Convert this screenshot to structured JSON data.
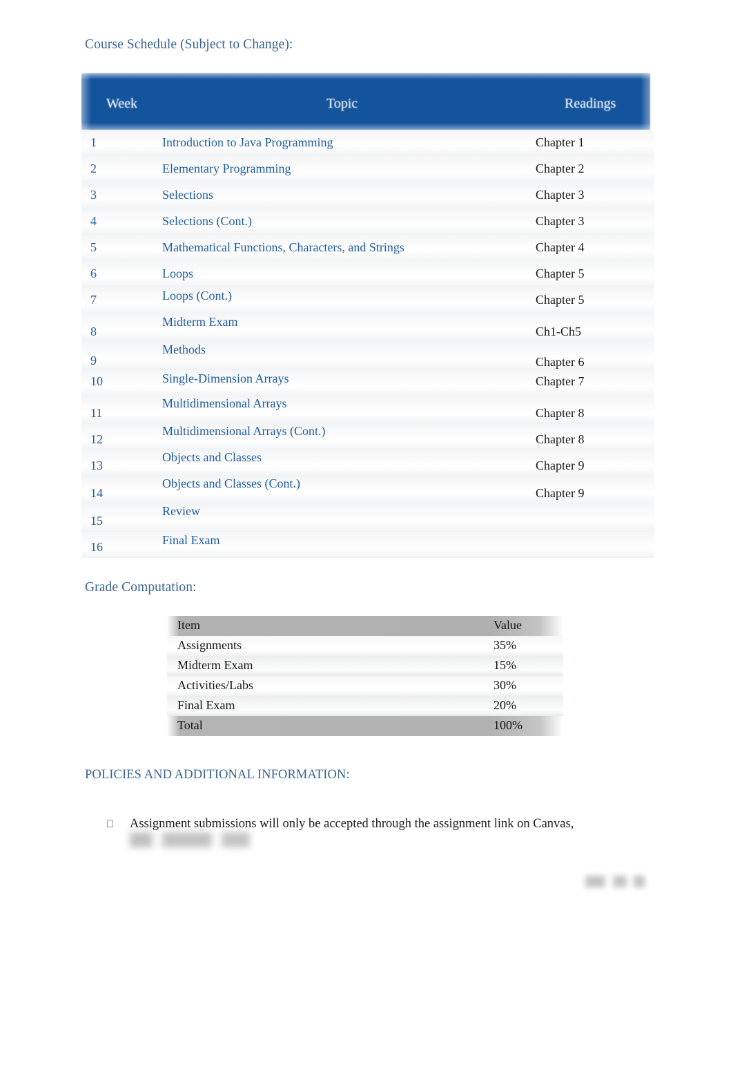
{
  "document": {
    "schedule_heading": "Course Schedule (Subject to Change):",
    "grades_heading": "Grade Computation:",
    "policies_heading": "POLICIES AND ADDITIONAL INFORMATION:"
  },
  "colors": {
    "table_header_blue": "#14549d",
    "body_text_blue": "#1f5c9e",
    "heading_blue": "#3a6490",
    "grade_header_gray": "#b2b2b2",
    "readings_text": "#1a1a1a"
  },
  "schedule_table": {
    "columns": [
      "Week",
      "Topic",
      "Readings"
    ],
    "rows": [
      {
        "week": "1",
        "topic": "Introduction to Java Programming",
        "readings": "Chapter 1"
      },
      {
        "week": "2",
        "topic": "Elementary Programming",
        "readings": "Chapter 2"
      },
      {
        "week": "3",
        "topic": "Selections",
        "readings": "Chapter 3"
      },
      {
        "week": "4",
        "topic": "Selections (Cont.)",
        "readings": "Chapter 3"
      },
      {
        "week": "5",
        "topic": "Mathematical Functions, Characters, and Strings",
        "readings": "Chapter 4"
      },
      {
        "week": "6",
        "topic": "Loops",
        "readings": "Chapter 5"
      },
      {
        "week": "7",
        "topic": "Loops (Cont.)",
        "readings": "Chapter 5"
      },
      {
        "week": "8",
        "topic": "Midterm Exam",
        "readings": "Ch1-Ch5"
      },
      {
        "week": "9",
        "topic": "Methods",
        "readings": "Chapter 6"
      },
      {
        "week": "10",
        "topic": "Single-Dimension Arrays",
        "readings": "Chapter 7"
      },
      {
        "week": "11",
        "topic": "Multidimensional Arrays",
        "readings": "Chapter 8"
      },
      {
        "week": "12",
        "topic": "Multidimensional Arrays (Cont.)",
        "readings": "Chapter 8"
      },
      {
        "week": "13",
        "topic": "Objects and Classes",
        "readings": "Chapter 9"
      },
      {
        "week": "14",
        "topic": "Objects and Classes (Cont.)",
        "readings": "Chapter 9"
      },
      {
        "week": "15",
        "topic": "Review",
        "readings": ""
      },
      {
        "week": "16",
        "topic": "Final Exam",
        "readings": ""
      }
    ]
  },
  "grade_table": {
    "columns": [
      "Item",
      "Value"
    ],
    "rows": [
      {
        "item": "Assignments",
        "value": "35%"
      },
      {
        "item": "Midterm Exam",
        "value": "15%"
      },
      {
        "item": "Activities/Labs",
        "value": "30%"
      },
      {
        "item": "Final Exam",
        "value": "20%"
      }
    ],
    "total": {
      "item": "Total",
      "value": "100%"
    }
  },
  "policies": {
    "bullet_glyph": "⎕",
    "items": [
      "Assignment submissions will only be accepted through the assignment link on Canvas,"
    ]
  }
}
